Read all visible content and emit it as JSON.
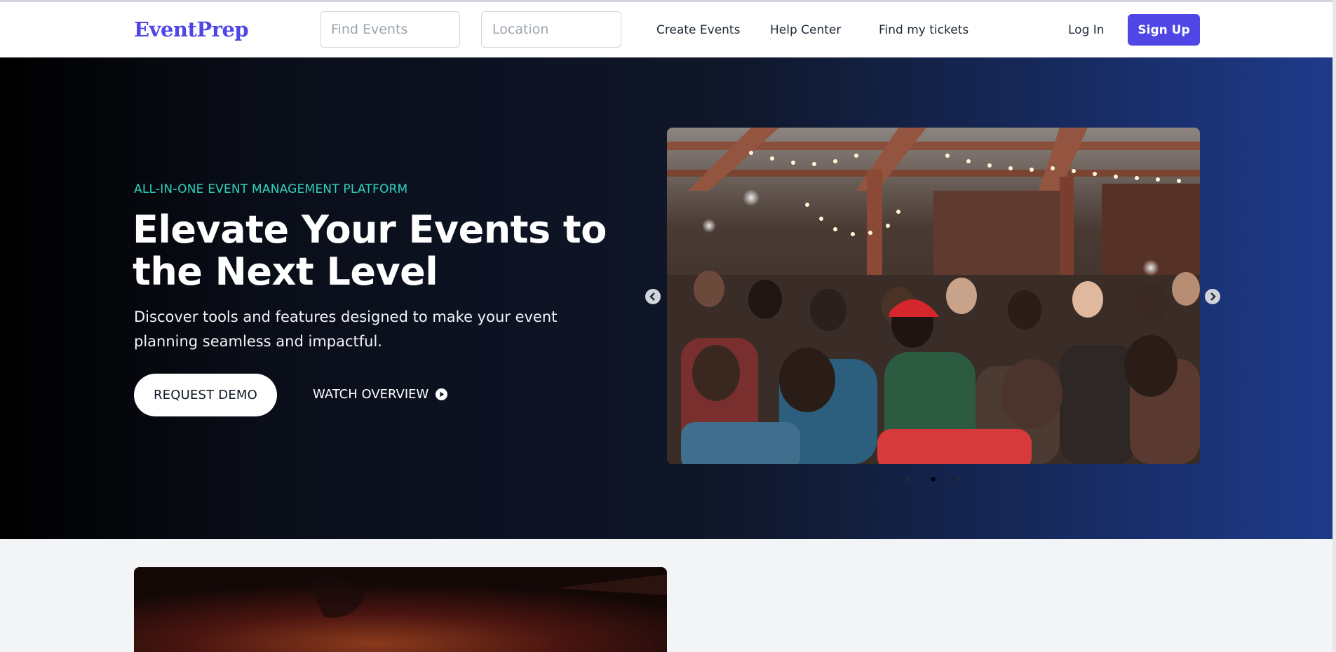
{
  "brand": {
    "name": "EventPrep",
    "color": "#4f46e5"
  },
  "nav": {
    "search_placeholder": "Find Events",
    "location_placeholder": "Location",
    "links": [
      "Create Events",
      "Help Center",
      "Find my tickets"
    ],
    "login_label": "Log In",
    "signup_label": "Sign Up"
  },
  "hero": {
    "eyebrow": "ALL-IN-ONE EVENT MANAGEMENT PLATFORM",
    "headline": "Elevate Your Events to the Next Level",
    "subtext": "Discover tools and features designed to make your event planning seamless and impactful.",
    "primary_cta": "REQUEST DEMO",
    "secondary_cta": "WATCH OVERVIEW",
    "secondary_icon": "play-circle-icon",
    "accent_color": "#2dd4bf"
  },
  "carousel": {
    "slide_count": 3,
    "active_slide": 2,
    "prev_icon": "chevron-left-circle-icon",
    "next_icon": "chevron-right-circle-icon"
  }
}
